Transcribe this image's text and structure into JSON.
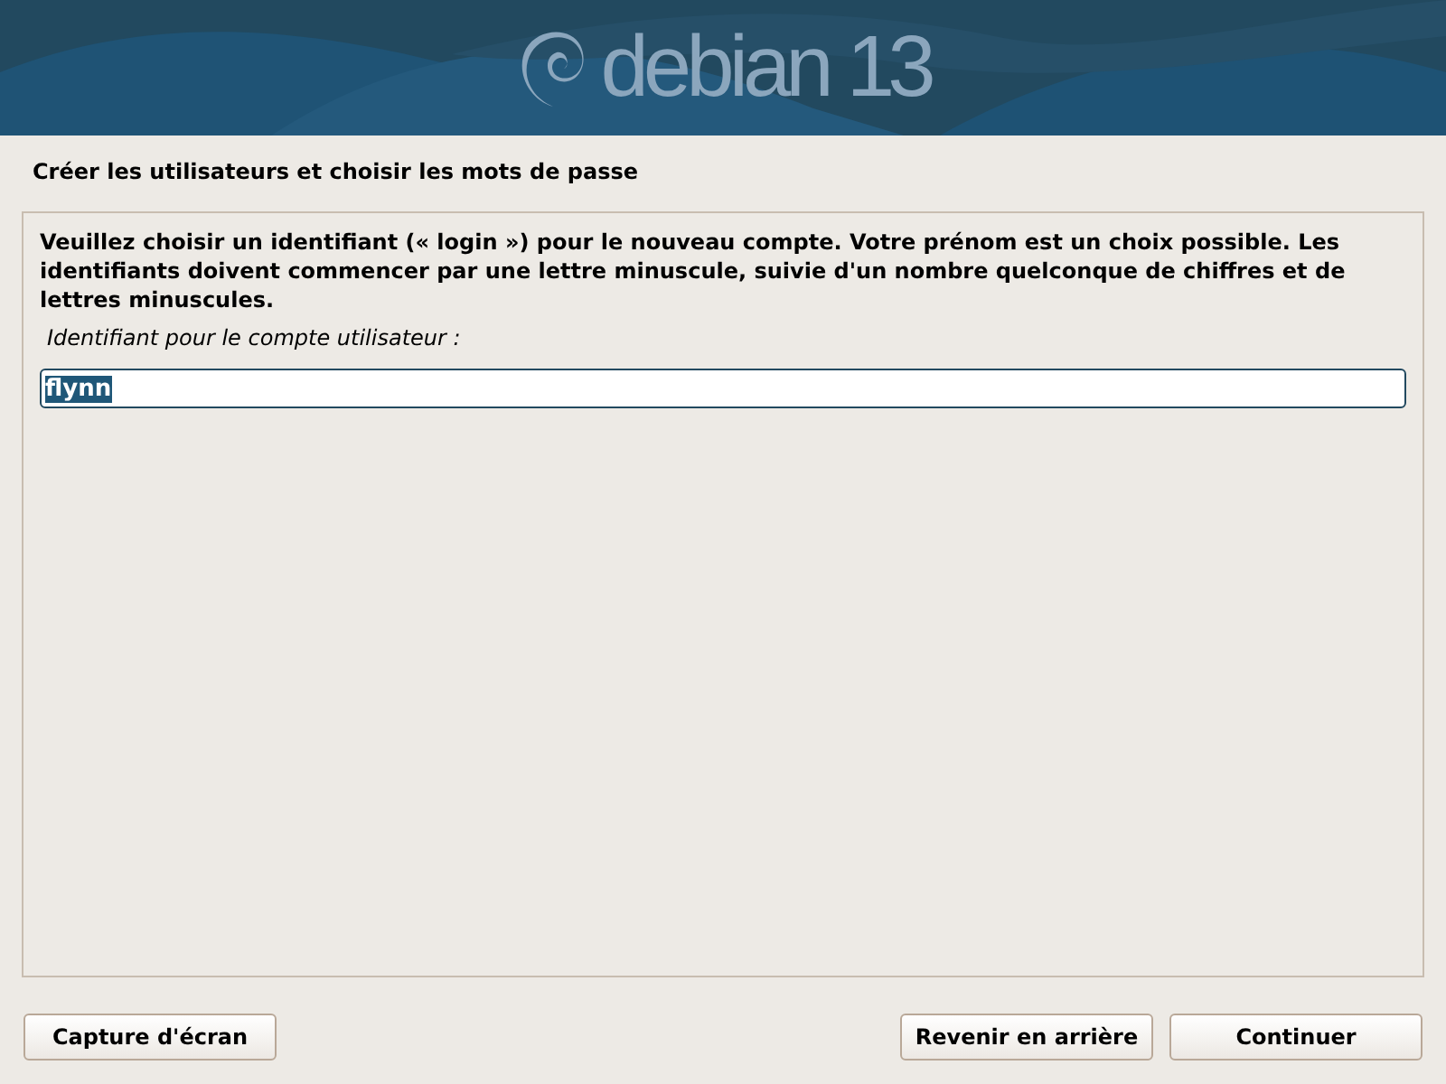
{
  "banner": {
    "logo_word": "debian",
    "logo_version": "13"
  },
  "title": "Créer les utilisateurs et choisir les mots de passe",
  "description": "Veuillez choisir un identifiant (« login ») pour le nouveau compte. Votre prénom est un choix possible. Les identifiants doivent commencer par une lettre minuscule, suivie d'un nombre quelconque de chiffres et de lettres minuscules.",
  "field": {
    "label": "Identifiant pour le compte utilisateur :",
    "value": "flynn",
    "text_selected": true
  },
  "left_buttons": [
    "Capture d'écran"
  ],
  "right_buttons": [
    "Revenir en arrière",
    "Continuer"
  ]
}
